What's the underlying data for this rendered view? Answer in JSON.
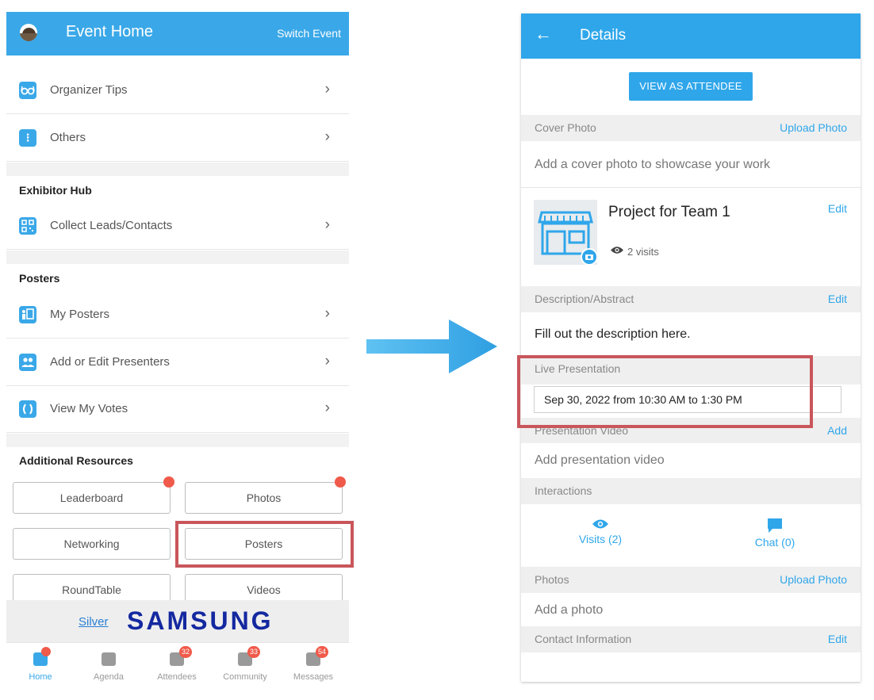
{
  "left": {
    "header": {
      "title": "Event Home",
      "switch_label": "Switch Event"
    },
    "rows_top": [
      {
        "label": "Organizer Tips",
        "icon": "glasses-icon"
      },
      {
        "label": "Others",
        "icon": "more-vertical-icon"
      }
    ],
    "exhibitor": {
      "heading": "Exhibitor Hub",
      "items": [
        {
          "label": "Collect Leads/Contacts",
          "icon": "qr-code-icon"
        }
      ]
    },
    "posters": {
      "heading": "Posters",
      "items": [
        {
          "label": "My Posters",
          "icon": "poster-icon"
        },
        {
          "label": "Add or Edit Presenters",
          "icon": "people-icon"
        },
        {
          "label": "View My Votes",
          "icon": "vote-icon"
        }
      ]
    },
    "resources": {
      "heading": "Additional Resources",
      "buttons": [
        "Leaderboard",
        "Photos",
        "Networking",
        "Posters",
        "RoundTable",
        "Videos"
      ]
    },
    "sponsor": {
      "tier": "Silver",
      "brand": "SAMSUNG"
    },
    "tabs": [
      {
        "label": "Home",
        "badge": ""
      },
      {
        "label": "Agenda",
        "badge": ""
      },
      {
        "label": "Attendees",
        "badge": "32"
      },
      {
        "label": "Community",
        "badge": "33"
      },
      {
        "label": "Messages",
        "badge": "54"
      }
    ]
  },
  "right": {
    "header": {
      "title": "Details",
      "back_icon": "arrow-left-icon"
    },
    "view_as_attendee": "VIEW AS ATTENDEE",
    "cover": {
      "label": "Cover Photo",
      "action": "Upload Photo",
      "placeholder": "Add a cover photo to showcase your work"
    },
    "project": {
      "name": "Project for Team 1",
      "visits": "2 visits",
      "edit": "Edit"
    },
    "description": {
      "label": "Description/Abstract",
      "edit": "Edit",
      "text": "Fill out the description here."
    },
    "live": {
      "label": "Live Presentation",
      "value": "Sep 30, 2022 from 10:30 AM to 1:30 PM"
    },
    "video": {
      "label": "Presentation Video",
      "action": "Add",
      "placeholder": "Add presentation video"
    },
    "interactions": {
      "label": "Interactions",
      "visits": "Visits (2)",
      "chat": "Chat (0)"
    },
    "photos": {
      "label": "Photos",
      "action": "Upload Photo",
      "placeholder": "Add a photo"
    },
    "contact": {
      "label": "Contact Information",
      "edit": "Edit"
    }
  },
  "colors": {
    "accent": "#2fa6ea",
    "highlight": "#c9565b",
    "badge": "#f05a4a",
    "samsung": "#1428a0"
  }
}
